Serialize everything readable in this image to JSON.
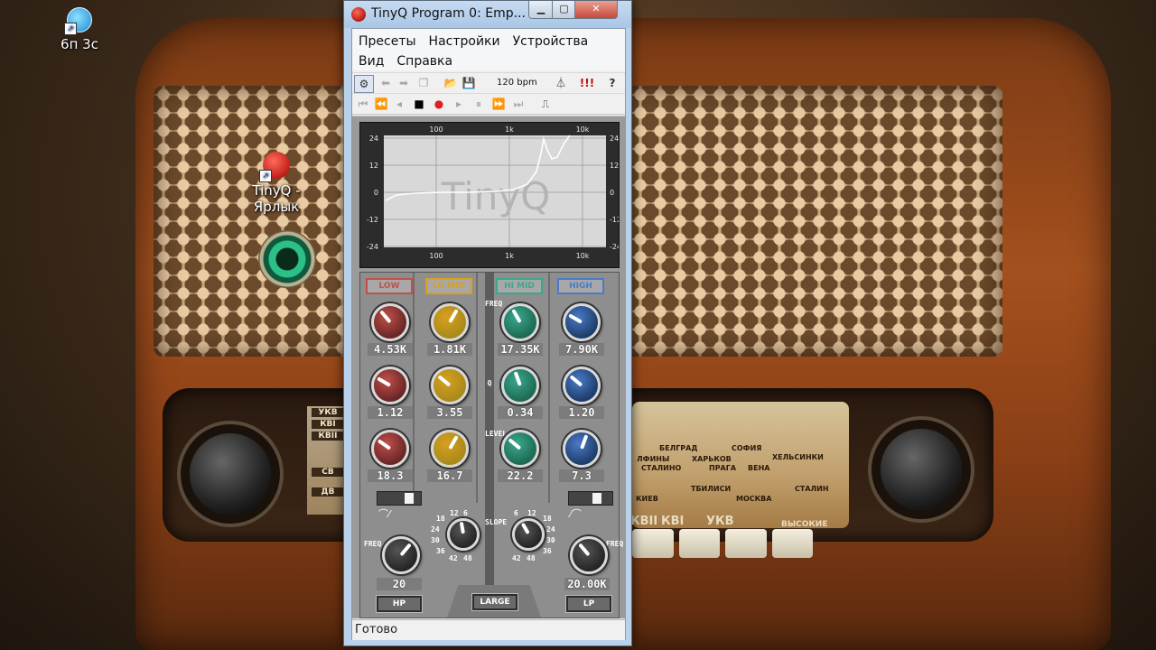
{
  "desktop": {
    "icons": [
      {
        "id": "network",
        "label": "6п 3с"
      },
      {
        "id": "tinyq",
        "label": "TinyQ - Ярлык"
      }
    ],
    "radio_band_labels": [
      "УКВ",
      "КВI",
      "КВII",
      "СВ",
      "ДВ"
    ],
    "radio_cities": [
      "БЕЛГРАД",
      "СОФИЯ",
      "ЛФИНЫ",
      "ХАРЬКОВ",
      "ХЕЛЬСИНКИ",
      "СТАЛИНО",
      "ПРАГА",
      "ВЕНА",
      "ТБИЛИСИ",
      "СТАЛИН",
      "МОСКВА",
      "КИЕВ"
    ],
    "radio_bottom_labels": [
      "КВII",
      "КВI",
      "УКВ",
      "ВЫСОКИЕ"
    ]
  },
  "window": {
    "title": "TinyQ Program 0: Emp...",
    "menu_row1": [
      "Пресеты",
      "Настройки",
      "Устройства"
    ],
    "menu_row2": [
      "Вид",
      "Справка"
    ],
    "toolbar": {
      "bpm": "120 bpm",
      "excl": "!!!",
      "help": "?"
    },
    "status": "Готово"
  },
  "plugin": {
    "watermark": "TinyQ",
    "graph": {
      "x_ticks_top": [
        "100",
        "1k",
        "10k"
      ],
      "x_ticks_bottom": [
        "100",
        "1k",
        "10k"
      ],
      "y_ticks": [
        "24",
        "12",
        "0",
        "-12",
        "-24"
      ]
    },
    "bands": [
      {
        "name": "LOW",
        "color": "#c0504a",
        "knob_color": "#6a2626",
        "freq": "4.53K",
        "q": "1.12",
        "level": "18.3"
      },
      {
        "name": "LO MID",
        "color": "#d8a020",
        "knob_color": "#a88a1a",
        "freq": "1.81K",
        "q": "3.55",
        "level": "16.7"
      },
      {
        "name": "HI MID",
        "color": "#3aa890",
        "knob_color": "#1e6a52",
        "freq": "17.35K",
        "q": "0.34",
        "level": "22.2"
      },
      {
        "name": "HIGH",
        "color": "#4a7ac8",
        "knob_color": "#1e3e6a",
        "freq": "7.90K",
        "q": "1.20",
        "level": "7.3"
      }
    ],
    "row_labels": {
      "freq": "FREQ",
      "q": "Q",
      "level": "LEVEL",
      "slope": "SLOPE"
    },
    "hp": {
      "freq": "20",
      "button": "HP",
      "freq_label": "FREQ"
    },
    "lp": {
      "freq": "20.00K",
      "button": "LP",
      "freq_label": "FREQ"
    },
    "size_button": "LARGE",
    "slope_scale_left": [
      "12",
      "6",
      "18",
      "24",
      "30",
      "36",
      "42",
      "48"
    ],
    "slope_scale_right": [
      "6",
      "12",
      "18",
      "24",
      "30",
      "36",
      "42",
      "48"
    ]
  }
}
